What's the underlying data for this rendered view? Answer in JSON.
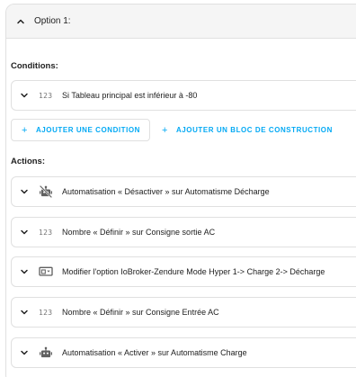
{
  "option": {
    "title": "Option 1:"
  },
  "conditions": {
    "heading": "Conditions:",
    "items": [
      {
        "icon": "numeric-icon",
        "icon_text": "123",
        "label": "Si Tableau principal est inférieur à -80"
      }
    ]
  },
  "buttons": {
    "add_condition": "AJOUTER UNE CONDITION",
    "add_building_block": "AJOUTER UN BLOC DE CONSTRUCTION"
  },
  "actions": {
    "heading": "Actions:",
    "items": [
      {
        "icon": "robot-off-icon",
        "label": "Automatisation « Désactiver » sur Automatisme Décharge"
      },
      {
        "icon": "numeric-icon",
        "icon_text": "123",
        "label": "Nombre « Définir » sur Consigne sortie AC"
      },
      {
        "icon": "form-dropdown-icon",
        "label": "Modifier l'option IoBroker-Zendure Mode Hyper 1-> Charge 2-> Décharge"
      },
      {
        "icon": "numeric-icon",
        "icon_text": "123",
        "label": "Nombre « Définir » sur Consigne Entrée AC"
      },
      {
        "icon": "robot-icon",
        "label": "Automatisation « Activer » sur Automatisme Charge"
      }
    ]
  },
  "colors": {
    "accent": "#03a9f4",
    "border": "#e0e0e0",
    "header_bg": "#f5f5f5",
    "icon": "#616161"
  }
}
